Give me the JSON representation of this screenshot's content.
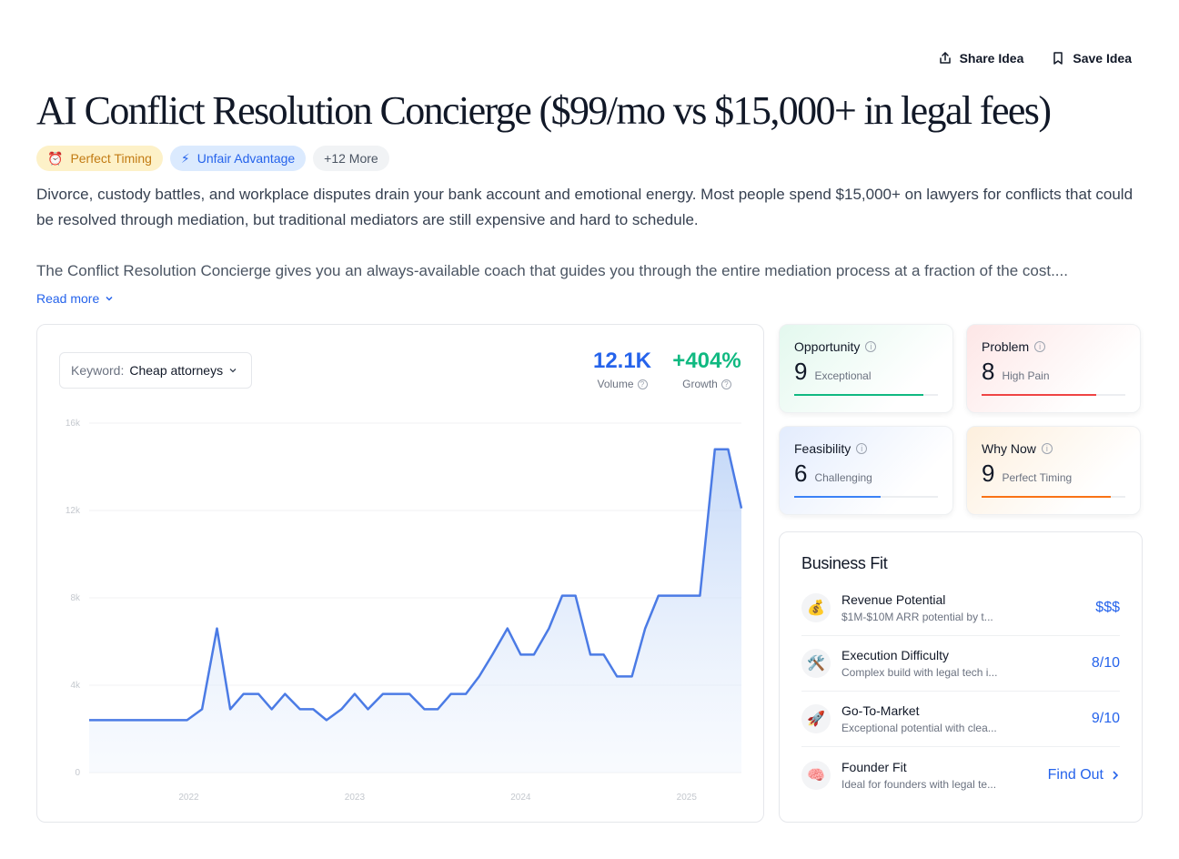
{
  "actions": {
    "share": "Share Idea",
    "save": "Save Idea"
  },
  "title": "AI Conflict Resolution Concierge ($99/mo vs $15,000+ in legal fees)",
  "badges": [
    {
      "icon": "⏰",
      "label": "Perfect Timing"
    },
    {
      "icon": "⚡",
      "label": "Unfair Advantage"
    },
    {
      "label": "+12 More"
    }
  ],
  "description": {
    "p1": "Divorce, custody battles, and workplace disputes drain your bank account and emotional energy. Most people spend $15,000+ on lawyers for conflicts that could be resolved through mediation, but traditional mediators are still expensive and hard to schedule.",
    "p2": "The Conflict Resolution Concierge gives you an always-available coach that guides you through the entire mediation process at a fraction of the cost....",
    "read_more": "Read more"
  },
  "keyword": {
    "label": "Keyword:",
    "value": "Cheap attorneys"
  },
  "metrics": {
    "volume": {
      "value": "12.1K",
      "label": "Volume"
    },
    "growth": {
      "value": "+404%",
      "label": "Growth"
    }
  },
  "chart_data": {
    "type": "area",
    "x_ticks": [
      "2022",
      "2023",
      "2024",
      "2025"
    ],
    "y_ticks": [
      "16k",
      "12k",
      "8k",
      "4k",
      "0"
    ],
    "ylim": [
      0,
      16000
    ],
    "xlim": [
      2021.4,
      2025.33
    ],
    "grid": true,
    "color": "#4b7be5",
    "points": [
      [
        2021.4,
        2400
      ],
      [
        2021.99,
        2400
      ],
      [
        2022.08,
        2900
      ],
      [
        2022.17,
        6600
      ],
      [
        2022.25,
        2900
      ],
      [
        2022.33,
        3600
      ],
      [
        2022.42,
        3600
      ],
      [
        2022.5,
        2900
      ],
      [
        2022.58,
        3600
      ],
      [
        2022.67,
        2900
      ],
      [
        2022.75,
        2900
      ],
      [
        2022.83,
        2400
      ],
      [
        2022.92,
        2900
      ],
      [
        2023.0,
        3600
      ],
      [
        2023.08,
        2900
      ],
      [
        2023.17,
        3600
      ],
      [
        2023.33,
        3600
      ],
      [
        2023.42,
        2900
      ],
      [
        2023.5,
        2900
      ],
      [
        2023.58,
        3600
      ],
      [
        2023.67,
        3600
      ],
      [
        2023.75,
        4400
      ],
      [
        2023.83,
        5400
      ],
      [
        2023.92,
        6600
      ],
      [
        2024.0,
        5400
      ],
      [
        2024.08,
        5400
      ],
      [
        2024.17,
        6600
      ],
      [
        2024.25,
        8100
      ],
      [
        2024.33,
        8100
      ],
      [
        2024.42,
        5400
      ],
      [
        2024.5,
        5400
      ],
      [
        2024.58,
        4400
      ],
      [
        2024.67,
        4400
      ],
      [
        2024.75,
        6600
      ],
      [
        2024.83,
        8100
      ],
      [
        2025.08,
        8100
      ],
      [
        2025.17,
        14800
      ],
      [
        2025.25,
        14800
      ],
      [
        2025.33,
        12100
      ]
    ]
  },
  "scores": {
    "opportunity": {
      "label": "Opportunity",
      "value": "9",
      "desc": "Exceptional",
      "fraction": 0.9,
      "color": "#10b981"
    },
    "problem": {
      "label": "Problem",
      "value": "8",
      "desc": "High Pain",
      "fraction": 0.8,
      "color": "#ef4444"
    },
    "feasibility": {
      "label": "Feasibility",
      "value": "6",
      "desc": "Challenging",
      "fraction": 0.6,
      "color": "#3b82f6"
    },
    "why_now": {
      "label": "Why Now",
      "value": "9",
      "desc": "Perfect Timing",
      "fraction": 0.9,
      "color": "#f97316"
    }
  },
  "business_fit": {
    "title": "Business Fit",
    "rows": [
      {
        "icon": "💰",
        "title": "Revenue Potential",
        "desc": "$1M-$10M ARR potential by t...",
        "value": "$$$"
      },
      {
        "icon": "🛠️",
        "title": "Execution Difficulty",
        "desc": "Complex build with legal tech i...",
        "value": "8/10"
      },
      {
        "icon": "🚀",
        "title": "Go-To-Market",
        "desc": "Exceptional potential with clea...",
        "value": "9/10"
      },
      {
        "icon": "🧠",
        "title": "Founder Fit",
        "desc": "Ideal for founders with legal te...",
        "value": "Find Out"
      }
    ]
  }
}
